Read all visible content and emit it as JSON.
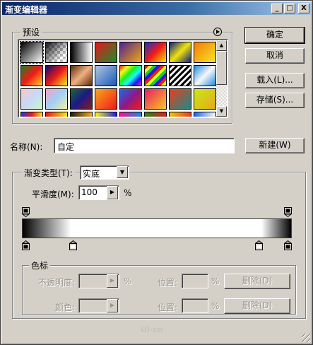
{
  "window": {
    "title": "渐变编辑器",
    "controls": [
      "_",
      "□",
      "X"
    ]
  },
  "presets": {
    "label": "预设",
    "menu_icon": "circle-arrow-icon",
    "swatches": [
      "linear-gradient(135deg,#000 0%,#fff 100%)",
      "transparent-black",
      "linear-gradient(90deg,#000,#fff)",
      "linear-gradient(135deg,#e8161c,#1a8e2a)",
      "linear-gradient(135deg,#4c2392,#f6a612)",
      "linear-gradient(135deg,#1234c8,#f01a1a,#f5e400)",
      "linear-gradient(135deg,#0a1a8a,#f0e40a,#0a1a8a)",
      "linear-gradient(135deg,#f07a10,#f8e81a)",
      "linear-gradient(135deg,#1a7e1a,#f01a1a,#f8d41a)",
      "linear-gradient(135deg,#0c0c6c,#e61a1a,#f8e81a)",
      "linear-gradient(135deg,#5a2a0a,#f0b080,#5a2a0a)",
      "linear-gradient(135deg,#b0c8e0,#1a58b8)",
      "linear-gradient(135deg,#f01a1a,#f8f81a,#1af01a,#1af8f8,#1a1af0,#f01af0)",
      "repeating-linear-gradient(135deg,#f01a1a 0 4px,#f8f81a 4px 8px,#1ad01a 8px 12px,#1a1af0 12px 16px)",
      "repeating-linear-gradient(135deg,#000 0 3px,#fff 3px 6px)",
      "linear-gradient(135deg,#1a8ae0,#f8f8f8,#1a8ae0)",
      "linear-gradient(135deg,#f8c8c8,#c8d8f8,#c8f8c8)",
      "linear-gradient(135deg,#f8a0c0,#a0d0f8,#f8f0a0)",
      "linear-gradient(135deg,#1a6a2a,#1a1a8a,#8a1a1a)",
      "linear-gradient(135deg,#f8a81a,#f01a1a)",
      "linear-gradient(135deg,#1a6ae8,#8a1a8a,#f01a1a)",
      "linear-gradient(135deg,#e81a6a,#f8c81a)",
      "linear-gradient(135deg,#e8401a,#1a8a8a)",
      "linear-gradient(135deg,#c8e81a,#e8a81a)",
      "linear-gradient(90deg,#1a3ae8,#e81a1a,#f8e81a)",
      "linear-gradient(90deg,#e81a1a,#f8e81a)",
      "linear-gradient(90deg,#1a1a1a,#f8a81a)",
      "linear-gradient(90deg,#f8f81a,#1a1ae8)",
      "linear-gradient(90deg,#e81a8a,#1a8ae8)",
      "linear-gradient(90deg,#1a8a1a,#e81a1a)",
      "linear-gradient(90deg,#e8c81a,#e8401a)",
      "linear-gradient(90deg,#1a6ae8,#f8f8f8)"
    ]
  },
  "buttons": {
    "ok": "确定",
    "cancel": "取消",
    "load": "载入(L)...",
    "save": "存储(S)...",
    "new": "新建(W)"
  },
  "name": {
    "label": "名称(N):",
    "value": "自定"
  },
  "gradient": {
    "group_label": "渐变类型(T):",
    "type_value": "实底",
    "smoothness_label": "平滑度(M):",
    "smoothness_value": "100",
    "percent": "%",
    "opacity_stops": [
      0,
      100
    ],
    "color_stops": [
      0,
      18,
      89,
      100
    ],
    "ramp": "linear-gradient(90deg,#000 0%,#fff 18%,#fff 89%,#000 100%)"
  },
  "stops": {
    "group_label": "色标",
    "opacity_label": "不透明度:",
    "opacity_unit": "%",
    "location_label": "位置:",
    "location_unit": "%",
    "delete_label": "删除(D)",
    "color_label": "颜色:",
    "location2_label": "位置:",
    "location2_unit": "%",
    "delete2_label": "删除(D)"
  },
  "watermark": "UI·cn"
}
